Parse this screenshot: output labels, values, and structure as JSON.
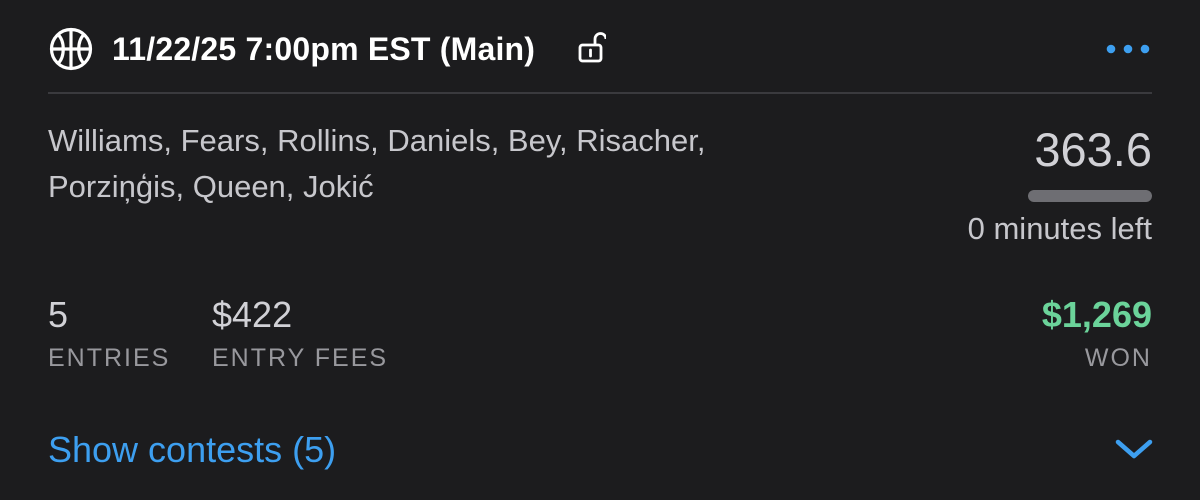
{
  "header": {
    "title": "11/22/25 7:00pm EST (Main)",
    "sport_icon": "basketball-icon",
    "lock_icon": "unlocked-padlock-icon",
    "more_icon": "more-horizontal-icon"
  },
  "lineup": {
    "players_line1": "Williams, Fears, Rollins, Daniels, Bey, Risacher,",
    "players_line2": "Porziņģis, Queen, Jokić"
  },
  "score": {
    "points": "363.6",
    "time_left": "0 minutes left",
    "progress": 1.0
  },
  "stats": {
    "entries_value": "5",
    "entries_label": "ENTRIES",
    "fees_value": "$422",
    "fees_label": "ENTRY FEES",
    "won_value": "$1,269",
    "won_label": "WON"
  },
  "footer": {
    "show_contests": "Show contests (5)",
    "chevron_icon": "chevron-down-icon"
  },
  "colors": {
    "card_background": "#1c1c1e",
    "accent_blue": "#3d9ff0",
    "won_green": "#6bd39a",
    "primary_text": "#ffffff",
    "secondary_text": "#c7c7cc"
  }
}
